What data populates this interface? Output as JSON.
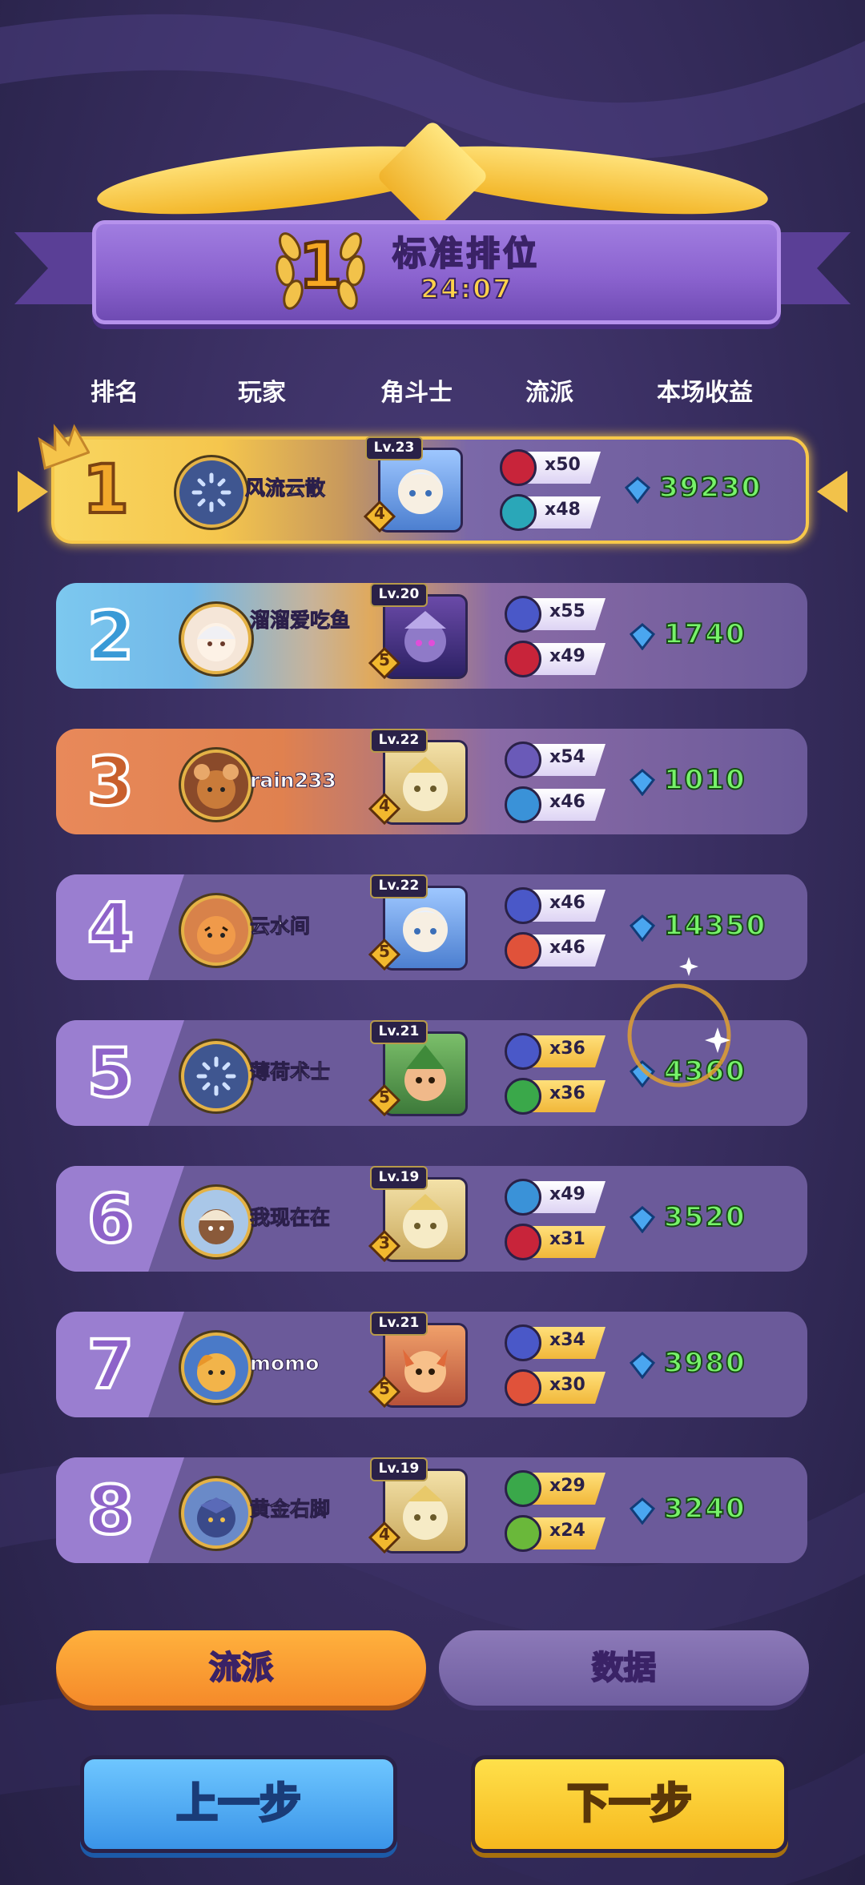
{
  "banner": {
    "rank": "1",
    "title": "标准排位",
    "time": "24:07"
  },
  "headers": {
    "rank": "排名",
    "player": "玩家",
    "fighter": "角斗士",
    "school": "流派",
    "earnings": "本场收益"
  },
  "rows": [
    {
      "rank": "1",
      "name": "风流云散",
      "level": "Lv.23",
      "stars": "4",
      "tags": [
        {
          "icon": "flame-icon",
          "count": "x50"
        },
        {
          "icon": "snowflake-icon",
          "count": "x48"
        }
      ],
      "earnings": "39230"
    },
    {
      "rank": "2",
      "name": "溜溜爱吃鱼",
      "level": "Lv.20",
      "stars": "5",
      "tags": [
        {
          "icon": "wing-icon",
          "count": "x55"
        },
        {
          "icon": "flame-icon",
          "count": "x49"
        }
      ],
      "earnings": "1740"
    },
    {
      "rank": "3",
      "name": "rain233",
      "level": "Lv.22",
      "stars": "4",
      "tags": [
        {
          "icon": "blade-icon",
          "count": "x54"
        },
        {
          "icon": "water-drop-icon",
          "count": "x46"
        }
      ],
      "earnings": "1010"
    },
    {
      "rank": "4",
      "name": "云水间",
      "level": "Lv.22",
      "stars": "5",
      "tags": [
        {
          "icon": "wing-icon",
          "count": "x46"
        },
        {
          "icon": "fire-orb-icon",
          "count": "x46"
        }
      ],
      "earnings": "14350"
    },
    {
      "rank": "5",
      "name": "薄荷术士",
      "level": "Lv.21",
      "stars": "5",
      "tags": [
        {
          "icon": "wing-icon",
          "count": "x36"
        },
        {
          "icon": "potion-icon",
          "count": "x36"
        }
      ],
      "earnings": "4360"
    },
    {
      "rank": "6",
      "name": "我现在在",
      "level": "Lv.19",
      "stars": "3",
      "tags": [
        {
          "icon": "water-drop-icon",
          "count": "x49"
        },
        {
          "icon": "flame-icon",
          "count": "x31"
        }
      ],
      "earnings": "3520"
    },
    {
      "rank": "7",
      "name": "momo",
      "level": "Lv.21",
      "stars": "5",
      "tags": [
        {
          "icon": "wing-icon",
          "count": "x34"
        },
        {
          "icon": "fire-orb-icon",
          "count": "x30"
        }
      ],
      "earnings": "3980"
    },
    {
      "rank": "8",
      "name": "黄金右脚",
      "level": "Lv.19",
      "stars": "4",
      "tags": [
        {
          "icon": "potion-icon",
          "count": "x29"
        },
        {
          "icon": "heal-cross-icon",
          "count": "x24"
        }
      ],
      "earnings": "3240"
    }
  ],
  "tabs": {
    "school": "流派",
    "stats": "数据"
  },
  "buttons": {
    "prev": "上一步",
    "next": "下一步"
  },
  "colors": {
    "gold": "#f7c84a",
    "blue": "#6ec3f0",
    "orange": "#e8895a",
    "purple": "#9a7ed0",
    "earnings_green": "#77f36a"
  }
}
